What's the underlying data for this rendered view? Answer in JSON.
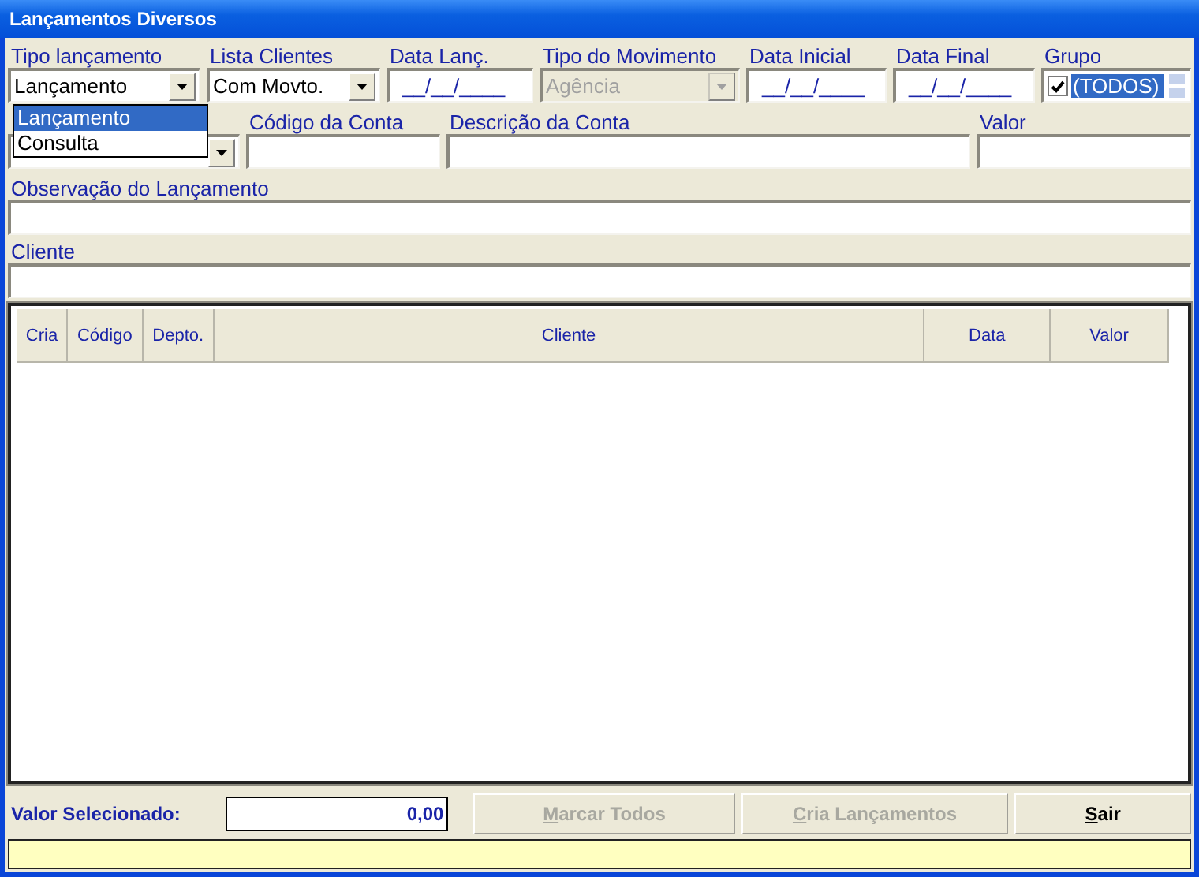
{
  "window": {
    "title": "Lançamentos Diversos"
  },
  "filters": [
    {
      "kind": "combo",
      "label": "Tipo lançamento",
      "value": "Lançamento",
      "disabled": false
    },
    {
      "kind": "combo",
      "label": "Lista Clientes",
      "value": "Com Movto.",
      "disabled": false
    },
    {
      "kind": "date",
      "label": "Data Lanç.",
      "value": "__/__/____",
      "disabled": false
    },
    {
      "kind": "combo",
      "label": "Tipo do Movimento",
      "value": "Agência",
      "disabled": true
    },
    {
      "kind": "date",
      "label": "Data Inicial",
      "value": "__/__/____",
      "disabled": false
    },
    {
      "kind": "date",
      "label": "Data Final",
      "value": "__/__/____",
      "disabled": false
    },
    {
      "kind": "group",
      "label": "Grupo",
      "value": "(TODOS)",
      "checked": true,
      "disabled": false
    }
  ],
  "dropdown": {
    "items": [
      {
        "label": "Lançamento",
        "selected": true
      },
      {
        "label": "Consulta",
        "selected": false
      }
    ]
  },
  "account_fields": [
    {
      "kind": "combo"
    },
    {
      "kind": "text",
      "label": "Código da Conta"
    },
    {
      "kind": "text",
      "label": "Descrição da Conta"
    },
    {
      "kind": "text",
      "label": "Valor"
    }
  ],
  "notes": {
    "label": "Observação do Lançamento"
  },
  "client": {
    "label": "Cliente"
  },
  "table": {
    "columns": [
      "Cria",
      "Código",
      "Depto.",
      "Cliente",
      "Data",
      "Valor"
    ]
  },
  "footer": {
    "label": "Valor Selecionado:",
    "value": "0,00"
  },
  "buttons": [
    {
      "label": "Marcar Todos",
      "disabled": true
    },
    {
      "label": "Cria Lançamentos",
      "disabled": true
    },
    {
      "label": "Sair",
      "disabled": false
    }
  ]
}
